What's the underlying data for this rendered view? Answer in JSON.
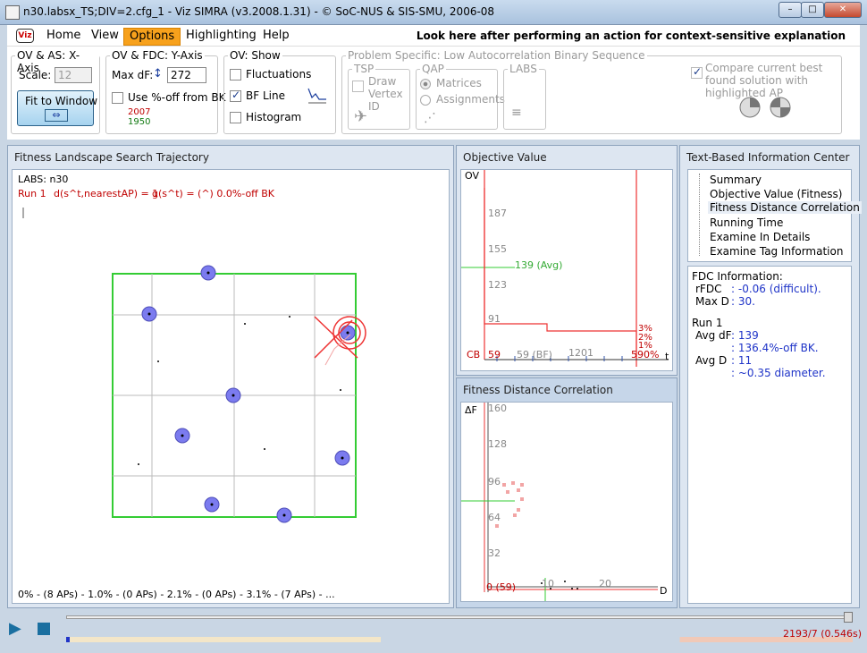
{
  "window": {
    "title": "n30.labsx_TS;DIV=2.cfg_1 - Viz SIMRA (v3.2008.1.31) - © SoC-NUS & SIS-SMU, 2006-08",
    "minimize": "–",
    "maximize": "□",
    "close": "✕"
  },
  "menu": {
    "logo": "Viz",
    "items": [
      "Home",
      "View",
      "Options",
      "Highlighting",
      "Help"
    ],
    "active": "Options",
    "help_message": "Look here after performing an action for context-sensitive explanation"
  },
  "toolbar": {
    "xaxis": {
      "title": "OV & AS: X-Axis",
      "scale_label": "Scale:",
      "scale_value": "12",
      "fit_label": "Fit to Window",
      "fit_icon": "⇔"
    },
    "yaxis": {
      "title": "OV & FDC: Y-Axis",
      "maxdf_label": "Max dF:",
      "maxdf_value": "272",
      "percent_label": "Use %-off from BK",
      "val_red": "2007",
      "val_green": "1950"
    },
    "ovshow": {
      "title": "OV: Show",
      "fluctuations": "Fluctuations",
      "bfline": "BF Line",
      "histogram": "Histogram"
    },
    "problem": {
      "title": "Problem Specific: Low Autocorrelation Binary Sequence",
      "tsp": "TSP",
      "draw_vertex": "Draw Vertex ID",
      "qap": "QAP",
      "matrices": "Matrices",
      "assignments": "Assignments",
      "labs": "LABS"
    },
    "compare": {
      "label": "Compare current best found solution with highlighted AP"
    }
  },
  "landscape": {
    "title": "Fitness Landscape Search Trajectory",
    "labs": "LABS: n30",
    "run": "Run 1",
    "d_label": "d(s^t,nearestAP) = 1",
    "g_label": "g(s^t) = (^) 0.0%-off BK",
    "footer": "0% - (8 APs) - 1.0% - (0 APs) - 2.1% - (0 APs) - 3.1% - (7 APs) - ..."
  },
  "objective": {
    "title": "Objective Value",
    "ov": "OV",
    "ticks": [
      "187",
      "155",
      "123",
      "91"
    ],
    "avg_label": "139 (Avg)",
    "cb": "CB",
    "x_labels": [
      "59",
      "59 (BF)",
      "1201",
      "590%"
    ],
    "t": "t",
    "pct_labels": [
      "3%",
      "2%",
      "1%"
    ]
  },
  "fdc": {
    "title": "Fitness Distance Correlation",
    "df": "ΔF",
    "ticks": [
      "160",
      "128",
      "96",
      "64",
      "32"
    ],
    "zero": "0 (59)",
    "x10": "10",
    "x20": "20",
    "d": "D"
  },
  "info": {
    "title": "Text-Based Information Center",
    "tree": [
      "Summary",
      "Objective Value (Fitness)",
      "Fitness Distance Correlation",
      "Running Time",
      "Examine In Details",
      "Examine Tag Information"
    ],
    "selected": "Fitness Distance Correlation",
    "fdc_header": "FDC Information:",
    "rfdc_label": "rFDC",
    "rfdc_value": ": -0.06 (difficult).",
    "maxd_label": "Max D",
    "maxd_value": ": 30.",
    "run": "Run 1",
    "avgdf_label": "Avg dF",
    "avgdf_value": ": 139",
    "avgdf_pct": ": 136.4%-off BK.",
    "avgd_label": "Avg D",
    "avgd_value": ": 11",
    "avgd_diam": ": ~0.35 diameter."
  },
  "status": {
    "counter": "2193/7 (0.546s)"
  }
}
